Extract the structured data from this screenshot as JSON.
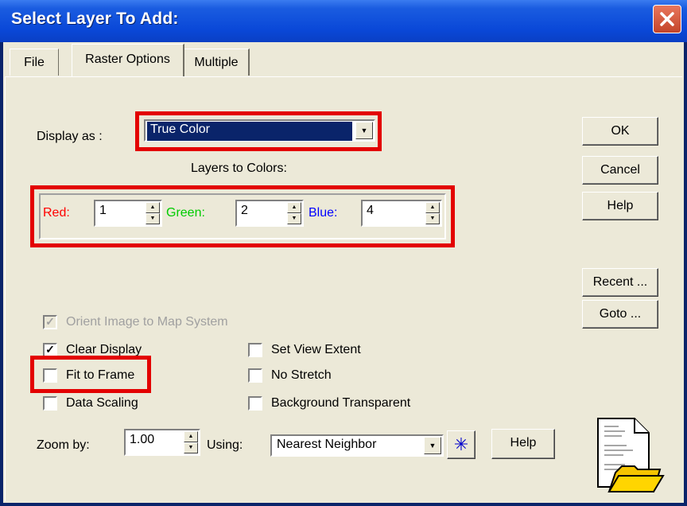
{
  "window": {
    "title": "Select Layer To Add:"
  },
  "tabs": [
    {
      "label": "File"
    },
    {
      "label": "Raster Options"
    },
    {
      "label": "Multiple"
    }
  ],
  "display_as": {
    "label": "Display as :",
    "value": "True Color"
  },
  "layers_to_colors": {
    "heading": "Layers to Colors:",
    "red_label": "Red:",
    "red_value": "1",
    "green_label": "Green:",
    "green_value": "2",
    "blue_label": "Blue:",
    "blue_value": "4"
  },
  "buttons": {
    "ok": "OK",
    "cancel": "Cancel",
    "help": "Help",
    "recent": "Recent ...",
    "goto": "Goto ...",
    "help2": "Help"
  },
  "checkboxes": {
    "orient": {
      "label": "Orient Image to Map System",
      "checked": true,
      "disabled": true
    },
    "clear_display": {
      "label": "Clear Display",
      "checked": true
    },
    "fit_to_frame": {
      "label": "Fit to Frame",
      "checked": false
    },
    "data_scaling": {
      "label": "Data Scaling",
      "checked": false
    },
    "set_view_extent": {
      "label": "Set View Extent",
      "checked": false
    },
    "no_stretch": {
      "label": "No Stretch",
      "checked": false
    },
    "background_transparent": {
      "label": "Background Transparent",
      "checked": false
    }
  },
  "zoom": {
    "label": "Zoom by:",
    "value": "1.00",
    "using_label": "Using:",
    "method": "Nearest Neighbor"
  },
  "colors": {
    "red": "#ff0000",
    "green": "#00cc00",
    "blue": "#0000ff",
    "highlight": "#e30000",
    "selection": "#0a246a"
  },
  "icons": {
    "close": "close-icon",
    "settings": "asterisk-icon",
    "file": "file-folder-icon"
  }
}
